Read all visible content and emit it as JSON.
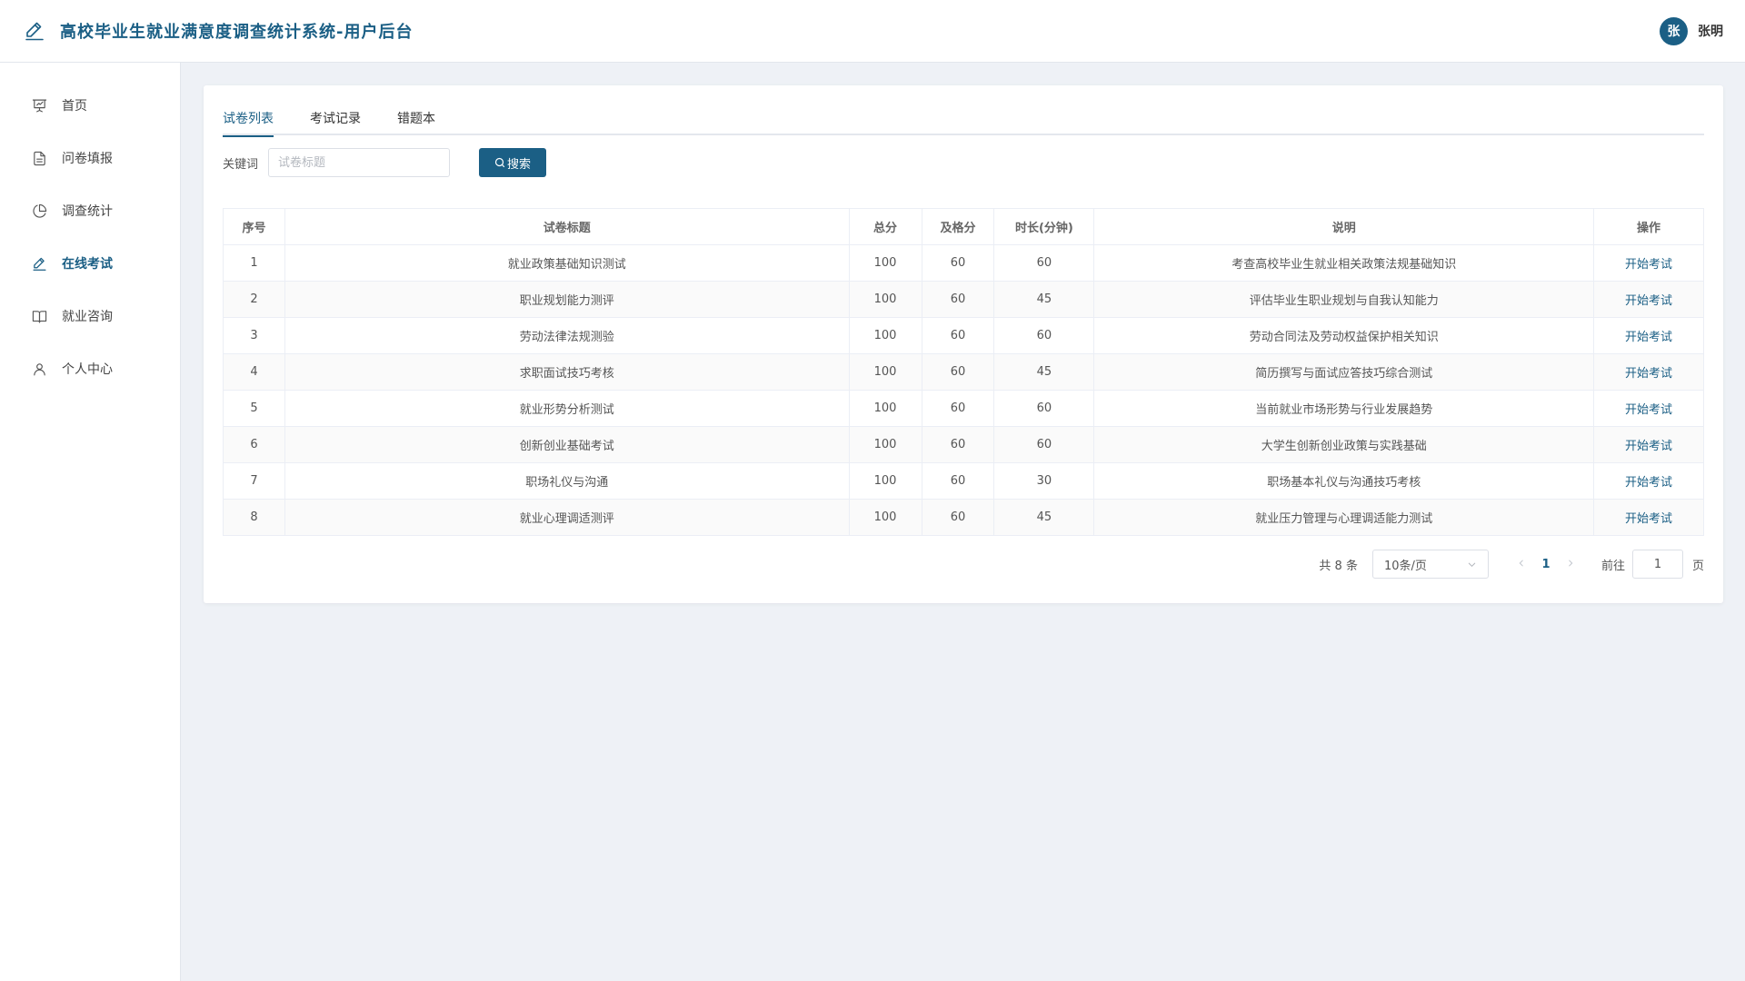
{
  "app": {
    "title": "高校毕业生就业满意度调查统计系统-用户后台",
    "user": {
      "avatar_char": "张",
      "name": "张明"
    },
    "accent_color": "#1b5f85"
  },
  "sidebar": {
    "items": [
      {
        "label": "首页",
        "icon": "presentation-icon",
        "active": false
      },
      {
        "label": "问卷填报",
        "icon": "document-icon",
        "active": false
      },
      {
        "label": "调查统计",
        "icon": "pie-chart-icon",
        "active": false
      },
      {
        "label": "在线考试",
        "icon": "edit-pen-icon",
        "active": true
      },
      {
        "label": "就业咨询",
        "icon": "book-icon",
        "active": false
      },
      {
        "label": "个人中心",
        "icon": "user-icon",
        "active": false
      }
    ]
  },
  "tabs": [
    {
      "label": "试卷列表",
      "active": true
    },
    {
      "label": "考试记录",
      "active": false
    },
    {
      "label": "错题本",
      "active": false
    }
  ],
  "search": {
    "label": "关键词",
    "placeholder": "试卷标题",
    "value": "",
    "button_label": "搜索"
  },
  "table": {
    "headers": [
      "序号",
      "试卷标题",
      "总分",
      "及格分",
      "时长(分钟)",
      "说明",
      "操作"
    ],
    "action_label": "开始考试",
    "rows": [
      [
        "1",
        "就业政策基础知识测试",
        "100",
        "60",
        "60",
        "考查高校毕业生就业相关政策法规基础知识"
      ],
      [
        "2",
        "职业规划能力测评",
        "100",
        "60",
        "45",
        "评估毕业生职业规划与自我认知能力"
      ],
      [
        "3",
        "劳动法律法规测验",
        "100",
        "60",
        "60",
        "劳动合同法及劳动权益保护相关知识"
      ],
      [
        "4",
        "求职面试技巧考核",
        "100",
        "60",
        "45",
        "简历撰写与面试应答技巧综合测试"
      ],
      [
        "5",
        "就业形势分析测试",
        "100",
        "60",
        "60",
        "当前就业市场形势与行业发展趋势"
      ],
      [
        "6",
        "创新创业基础考试",
        "100",
        "60",
        "60",
        "大学生创新创业政策与实践基础"
      ],
      [
        "7",
        "职场礼仪与沟通",
        "100",
        "60",
        "30",
        "职场基本礼仪与沟通技巧考核"
      ],
      [
        "8",
        "就业心理调适测评",
        "100",
        "60",
        "45",
        "就业压力管理与心理调适能力测试"
      ]
    ]
  },
  "pagination": {
    "total_text": "共 8 条",
    "page_size": "10条/页",
    "current_page": "1",
    "goto_label": "前往",
    "goto_value": "1",
    "page_unit": "页"
  }
}
